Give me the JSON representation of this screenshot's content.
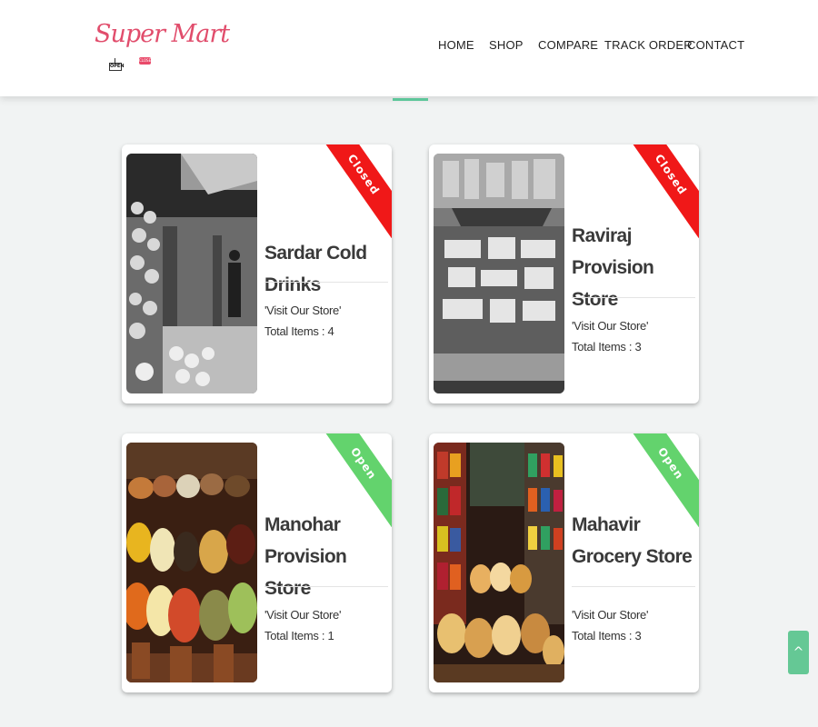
{
  "logo": {
    "text": "Super Mart",
    "open_sign": "OPEN",
    "close_tag": "CLOSE"
  },
  "nav": {
    "items": [
      "HOME",
      "SHOP",
      "COMPARE",
      "TRACK ORDER",
      "CONTACT"
    ]
  },
  "stores": [
    {
      "name": "Sardar Cold Drinks",
      "status": "Closed",
      "visit_label": "'Visit Our Store'",
      "items_label": "Total Items : 4",
      "photo_icon": "market-stall-bw-photo"
    },
    {
      "name": "Raviraj Provision Store",
      "status": "Closed",
      "visit_label": "'Visit Our Store'",
      "items_label": "Total Items : 3",
      "photo_icon": "grocery-counter-bw-photo"
    },
    {
      "name": "Manohar Provision Store",
      "status": "Open",
      "visit_label": "'Visit Our Store'",
      "items_label": "Total Items : 1",
      "photo_icon": "spice-bags-photo"
    },
    {
      "name": "Mahavir Grocery Store",
      "status": "Open",
      "visit_label": "'Visit Our Store'",
      "items_label": "Total Items : 3",
      "photo_icon": "grocery-shelves-photo"
    }
  ],
  "scroll_top": {
    "label": "^"
  },
  "colors": {
    "closed": "#f01818",
    "open": "#63d36d",
    "accent": "#5dc69a",
    "logo": "#e14d6c"
  }
}
